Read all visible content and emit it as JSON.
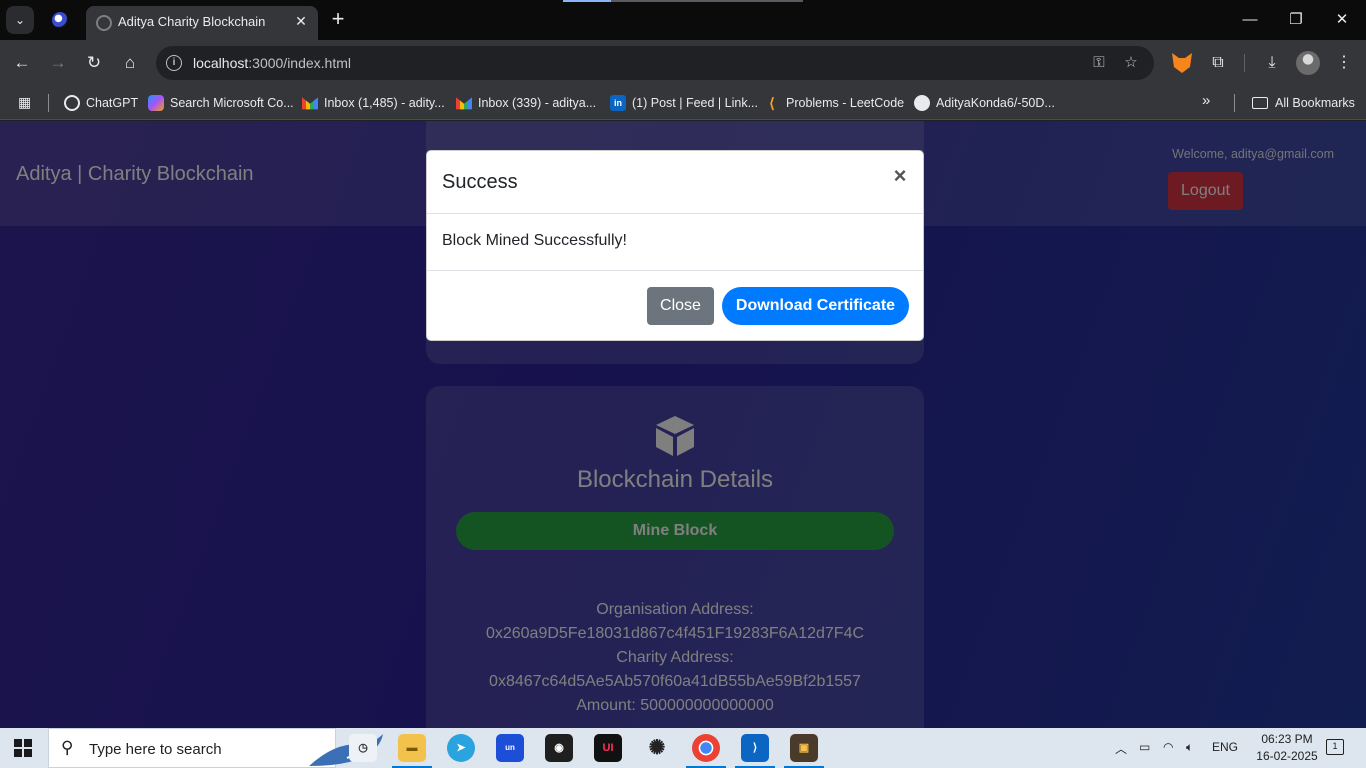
{
  "browser": {
    "tab_title": "Aditya Charity Blockchain",
    "url_host": "localhost",
    "url_rest": ":3000/index.html",
    "bookmarks": [
      {
        "label": "ChatGPT",
        "icon": "chatgpt-icon"
      },
      {
        "label": "Search Microsoft Co...",
        "icon": "copilot-icon"
      },
      {
        "label": "Inbox (1,485) - adity...",
        "icon": "gmail-icon"
      },
      {
        "label": "Inbox (339) - aditya...",
        "icon": "gmail-icon"
      },
      {
        "label": "(1) Post | Feed | Link...",
        "icon": "linkedin-icon"
      },
      {
        "label": "Problems - LeetCode",
        "icon": "leetcode-icon"
      },
      {
        "label": "AdityaKonda6/-50D...",
        "icon": "github-icon"
      }
    ],
    "all_bookmarks": "All Bookmarks"
  },
  "app": {
    "brand": "Aditya | Charity Blockchain",
    "welcome": "Welcome, aditya@gmail.com",
    "logout": "Logout",
    "card_title": "Blockchain Details",
    "mine_button": "Mine Block",
    "org_address_label": "Organisation Address:",
    "org_address": "0x260a9D5Fe18031d867c4f451F19283F6A12d7F4C",
    "charity_address_label": "Charity Address:",
    "charity_address": "0x8467c64d5Ae5Ab570f60a41dB55bAe59Bf2b1557",
    "amount": "Amount: 500000000000000"
  },
  "modal": {
    "title": "Success",
    "close_x": "×",
    "message": "Block Mined Successfully!",
    "close_button": "Close",
    "download_button": "Download Certificate"
  },
  "taskbar": {
    "search_placeholder": "Type here to search",
    "language": "ENG",
    "time": "06:23 PM",
    "date": "16-02-2025",
    "notification_count": "1"
  },
  "colors": {
    "page_gradient_start": "#3a2a98",
    "page_gradient_end": "#243a9e",
    "mine_button": "#28a745",
    "logout_button": "#dc3545",
    "download_button": "#007bff",
    "close_button": "#6c757d"
  }
}
